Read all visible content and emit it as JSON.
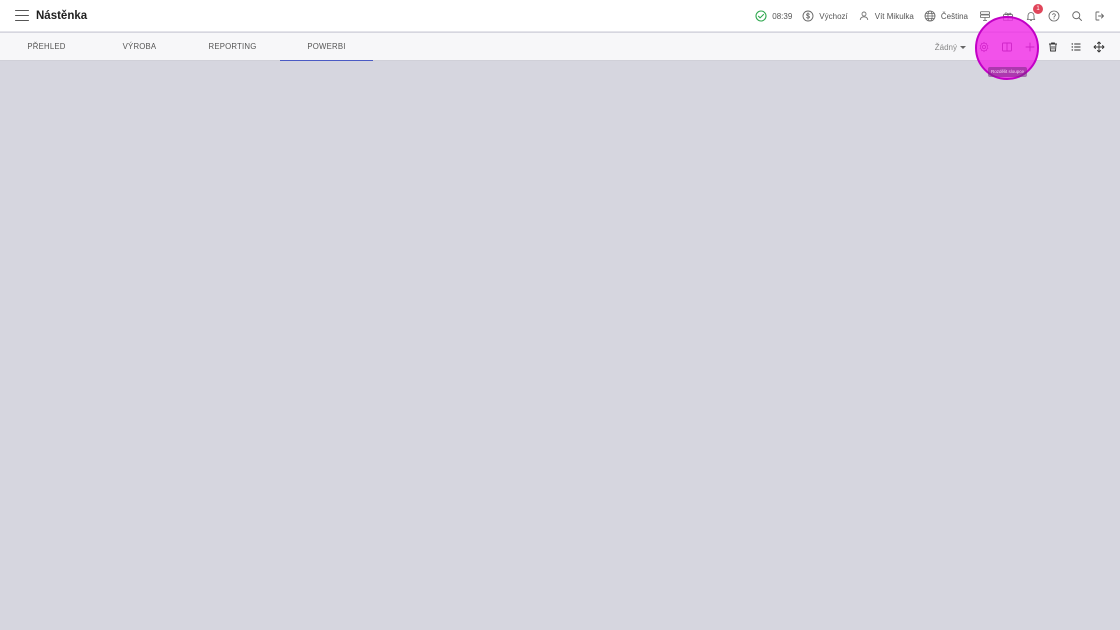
{
  "header": {
    "title": "Nástěnka",
    "time": "08:39",
    "currency": "Výchozí",
    "user": "Vít Mikulka",
    "language": "Čeština",
    "notification_count": "1",
    "icons": [
      "menu-icon",
      "check-circle-icon",
      "dollar-circle-icon",
      "user-icon",
      "globe-icon",
      "layers-icon",
      "gift-icon",
      "bell-icon",
      "help-icon",
      "search-icon",
      "logout-icon"
    ]
  },
  "tabs": [
    {
      "label": "PŘEHLED",
      "active": false
    },
    {
      "label": "VÝROBA",
      "active": false
    },
    {
      "label": "REPORTING",
      "active": false
    },
    {
      "label": "POWERBI",
      "active": true
    }
  ],
  "toolbar": {
    "filter_value": "Žádný",
    "icons": [
      "settings-icon",
      "columns-icon",
      "plus-icon",
      "trash-icon",
      "list-icon",
      "move-icon"
    ],
    "tooltip": "Rozdělit sloupce"
  },
  "colors": {
    "accent": "#4b5bc4",
    "highlight": "#f02de6",
    "badge": "#e0455a",
    "background": "#d6d6df",
    "status_ok": "#2fa84f"
  }
}
